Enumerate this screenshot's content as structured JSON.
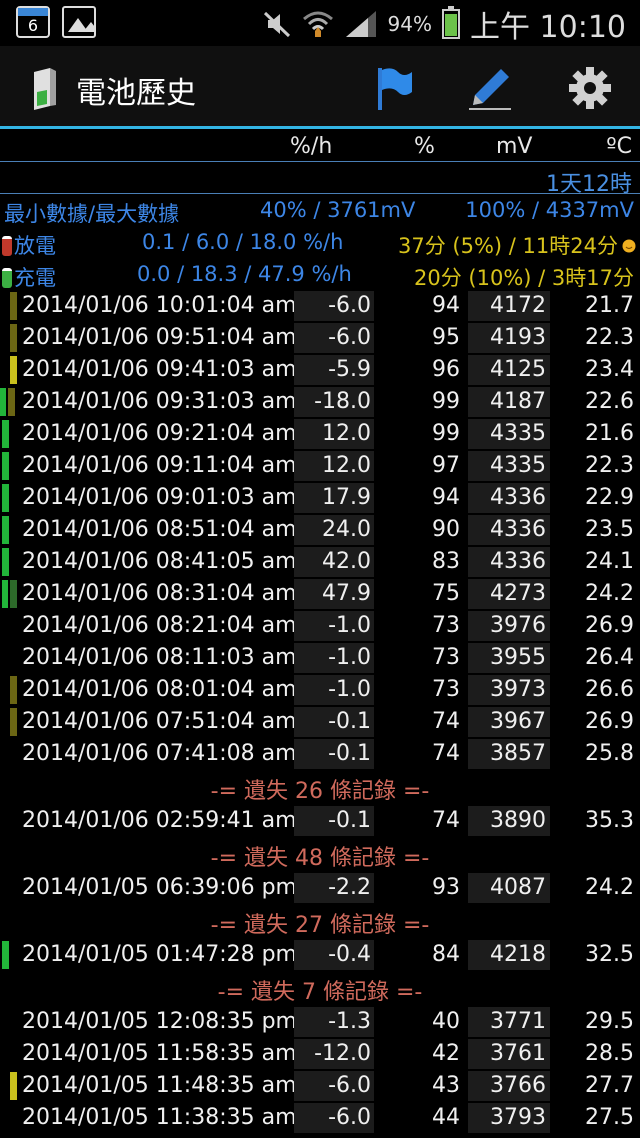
{
  "status_bar": {
    "calendar_day": "6",
    "battery_percent": "94%",
    "time": "上午 10:10"
  },
  "app_bar": {
    "title": "電池歷史"
  },
  "columns": {
    "rate": "%/h",
    "percent": "%",
    "voltage": "mV",
    "temp": "ºC"
  },
  "duration": "1天12時",
  "summary": {
    "minmax_label": "最小數據/最大數據",
    "min": "40% / 3761mV",
    "max": "100% / 4337mV",
    "discharge_label": "放電",
    "discharge_rates": "0.1 / 6.0 / 18.0 %/h",
    "discharge_time": "37分 (5%) / 11時24分",
    "charge_label": "充電",
    "charge_rates": "0.0 / 18.3 / 47.9 %/h",
    "charge_time": "20分 (10%) / 3時17分"
  },
  "colors": {
    "accent": "#33b5e5",
    "discharge_dark": "#6b6614",
    "discharge_bright": "#c9c01d",
    "charge_bright": "#22b53a",
    "charge_dark": "#2d6a2a",
    "gap_text": "#d06a5c"
  },
  "icons": [
    "battery-logo-icon",
    "flag-icon",
    "pen-icon",
    "gear-icon",
    "calendar-icon",
    "gallery-icon",
    "mute-icon",
    "wifi-icon",
    "signal-icon",
    "battery-icon"
  ],
  "records": [
    {
      "date": "2014/01/06 10:01:04 am",
      "rate": "-6.0",
      "pct": "94",
      "mv": "4172",
      "temp": "21.7",
      "bar": "dd"
    },
    {
      "date": "2014/01/06 09:51:04 am",
      "rate": "-6.0",
      "pct": "95",
      "mv": "4193",
      "temp": "22.3",
      "bar": "dd"
    },
    {
      "date": "2014/01/06 09:41:03 am",
      "rate": "-5.9",
      "pct": "96",
      "mv": "4125",
      "temp": "23.4",
      "bar": "db"
    },
    {
      "date": "2014/01/06 09:31:03 am",
      "rate": "-18.0",
      "pct": "99",
      "mv": "4187",
      "temp": "22.6",
      "bar": "cdb"
    },
    {
      "date": "2014/01/06 09:21:04 am",
      "rate": "12.0",
      "pct": "99",
      "mv": "4335",
      "temp": "21.6",
      "bar": "cb"
    },
    {
      "date": "2014/01/06 09:11:04 am",
      "rate": "12.0",
      "pct": "97",
      "mv": "4335",
      "temp": "22.3",
      "bar": "cb"
    },
    {
      "date": "2014/01/06 09:01:03 am",
      "rate": "17.9",
      "pct": "94",
      "mv": "4336",
      "temp": "22.9",
      "bar": "cb"
    },
    {
      "date": "2014/01/06 08:51:04 am",
      "rate": "24.0",
      "pct": "90",
      "mv": "4336",
      "temp": "23.5",
      "bar": "cb"
    },
    {
      "date": "2014/01/06 08:41:05 am",
      "rate": "42.0",
      "pct": "83",
      "mv": "4336",
      "temp": "24.1",
      "bar": "cb"
    },
    {
      "date": "2014/01/06 08:31:04 am",
      "rate": "47.9",
      "pct": "75",
      "mv": "4273",
      "temp": "24.2",
      "bar": "cd"
    },
    {
      "date": "2014/01/06 08:21:04 am",
      "rate": "-1.0",
      "pct": "73",
      "mv": "3976",
      "temp": "26.9",
      "bar": ""
    },
    {
      "date": "2014/01/06 08:11:03 am",
      "rate": "-1.0",
      "pct": "73",
      "mv": "3955",
      "temp": "26.4",
      "bar": ""
    },
    {
      "date": "2014/01/06 08:01:04 am",
      "rate": "-1.0",
      "pct": "73",
      "mv": "3973",
      "temp": "26.6",
      "bar": "dd"
    },
    {
      "date": "2014/01/06 07:51:04 am",
      "rate": "-0.1",
      "pct": "74",
      "mv": "3967",
      "temp": "26.9",
      "bar": "dd"
    },
    {
      "date": "2014/01/06 07:41:08 am",
      "rate": "-0.1",
      "pct": "74",
      "mv": "3857",
      "temp": "25.8",
      "bar": ""
    },
    {
      "gap": "-= 遺失 26 條記錄 =-"
    },
    {
      "date": "2014/01/06 02:59:41 am",
      "rate": "-0.1",
      "pct": "74",
      "mv": "3890",
      "temp": "35.3",
      "bar": ""
    },
    {
      "gap": "-= 遺失 48 條記錄 =-"
    },
    {
      "date": "2014/01/05 06:39:06 pm",
      "rate": "-2.2",
      "pct": "93",
      "mv": "4087",
      "temp": "24.2",
      "bar": ""
    },
    {
      "gap": "-= 遺失 27 條記錄 =-"
    },
    {
      "date": "2014/01/05 01:47:28 pm",
      "rate": "-0.4",
      "pct": "84",
      "mv": "4218",
      "temp": "32.5",
      "bar": "cb"
    },
    {
      "gap": "-= 遺失 7 條記錄 =-"
    },
    {
      "date": "2014/01/05 12:08:35 pm",
      "rate": "-1.3",
      "pct": "40",
      "mv": "3771",
      "temp": "29.5",
      "bar": ""
    },
    {
      "date": "2014/01/05 11:58:35 am",
      "rate": "-12.0",
      "pct": "42",
      "mv": "3761",
      "temp": "28.5",
      "bar": ""
    },
    {
      "date": "2014/01/05 11:48:35 am",
      "rate": "-6.0",
      "pct": "43",
      "mv": "3766",
      "temp": "27.7",
      "bar": "db"
    },
    {
      "date": "2014/01/05 11:38:35 am",
      "rate": "-6.0",
      "pct": "44",
      "mv": "3793",
      "temp": "27.5",
      "bar": ""
    }
  ]
}
